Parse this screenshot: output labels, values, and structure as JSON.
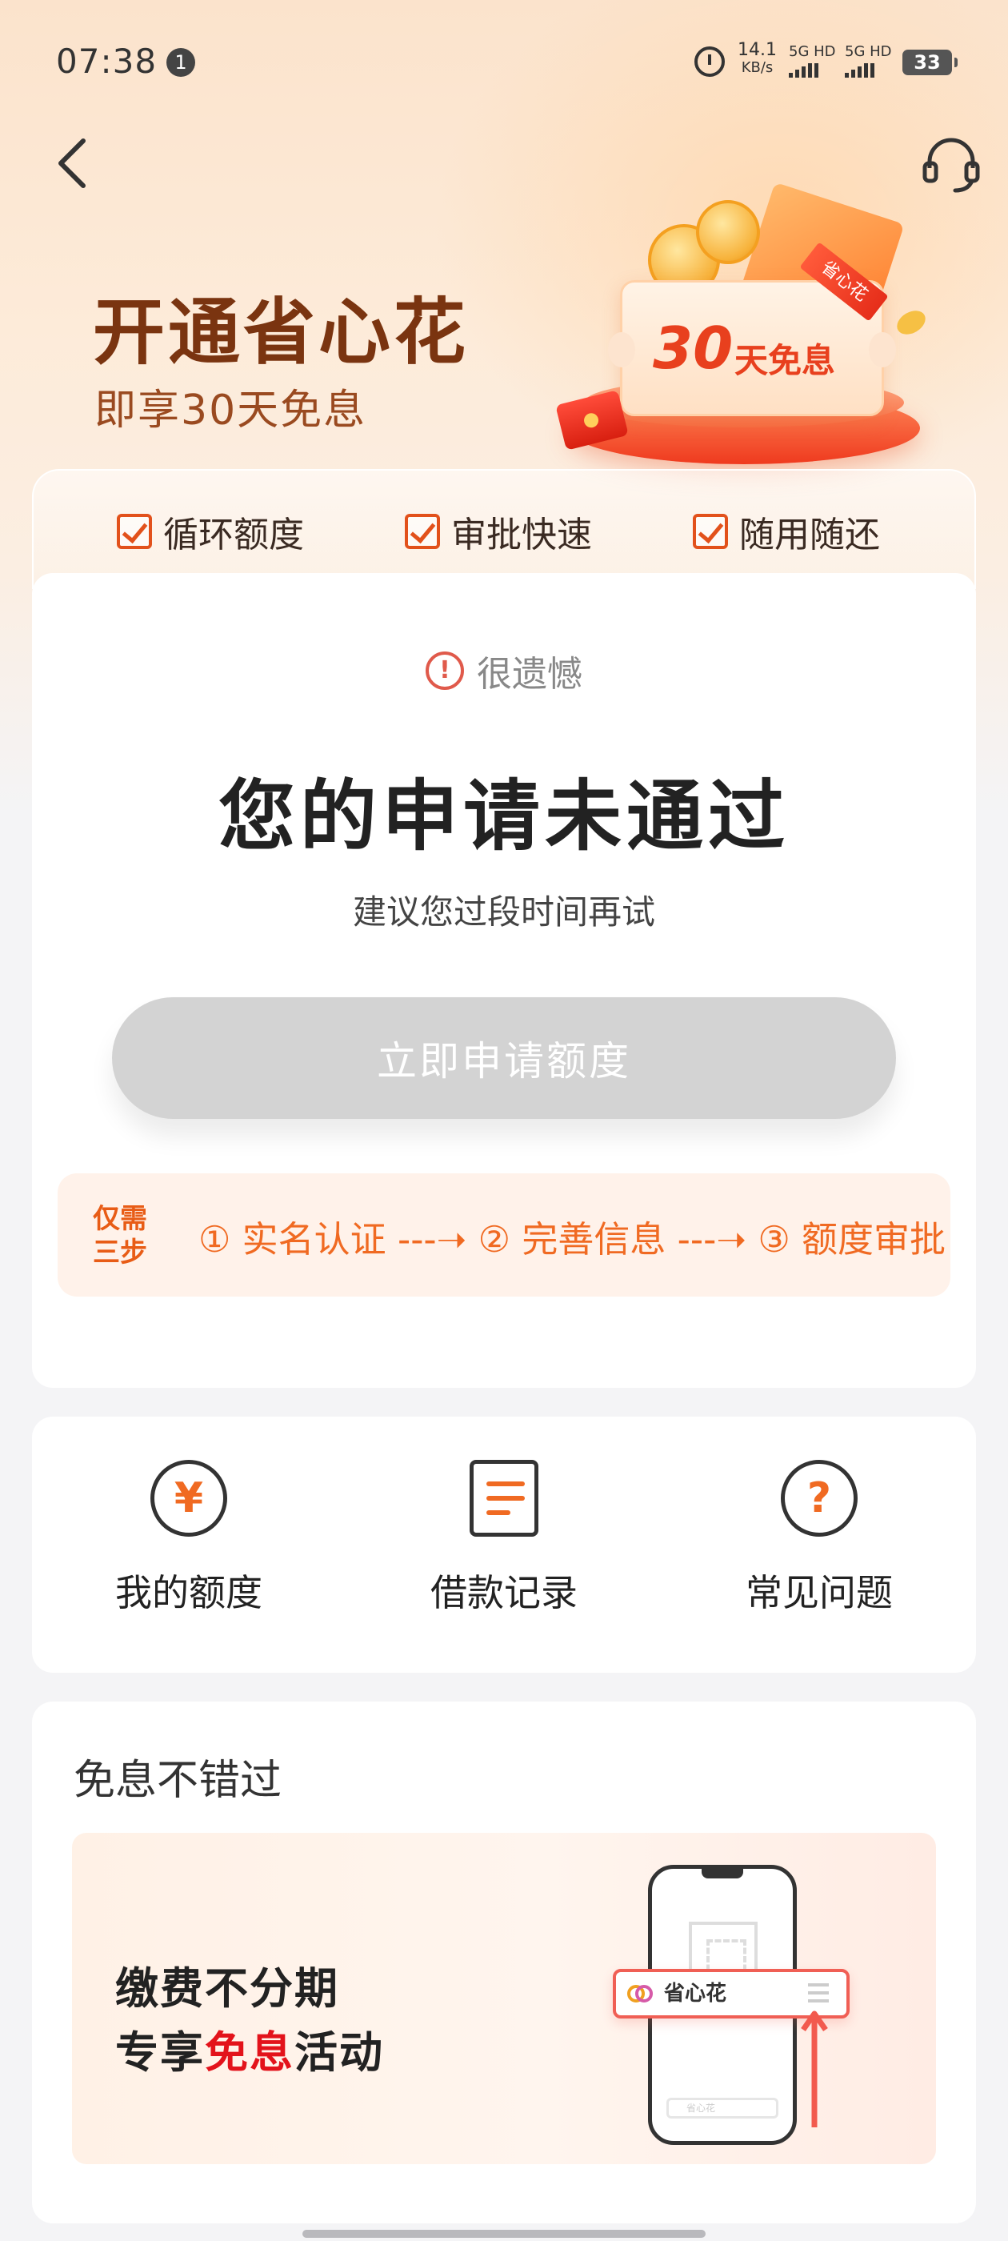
{
  "status_bar": {
    "time": "07:38",
    "notification_count": "1",
    "speed_value": "14.1",
    "speed_unit": "KB/s",
    "sim1_label": "5G HD",
    "sim2_label": "5G HD",
    "battery": "33"
  },
  "nav": {
    "back_icon": "chevron-left-icon",
    "service_icon": "headset-icon"
  },
  "hero": {
    "title": "开通省心花",
    "subtitle": "即享30天免息",
    "coupon_number": "30",
    "coupon_text": "天免息",
    "coupon_ribbon": "省心花"
  },
  "features": [
    {
      "label": "循环额度"
    },
    {
      "label": "审批快速"
    },
    {
      "label": "随用随还"
    }
  ],
  "result": {
    "notice": "很遗憾",
    "title": "您的申请未通过",
    "subtitle": "建议您过段时间再试",
    "apply_button": "立即申请额度"
  },
  "steps": {
    "tag_line1": "仅需",
    "tag_line2": "三步",
    "text": "① 实名认证 ---➝ ② 完善信息 ---➝ ③ 额度审批"
  },
  "quick_links": [
    {
      "label": "我的额度",
      "icon": "yen-circle-icon",
      "glyph": "¥"
    },
    {
      "label": "借款记录",
      "icon": "document-list-icon"
    },
    {
      "label": "常见问题",
      "icon": "question-circle-icon",
      "glyph": "?"
    }
  ],
  "promo": {
    "section_title": "免息不错过",
    "line1": "缴费不分期",
    "line2_prefix": "专享",
    "line2_highlight": "免息",
    "line2_suffix": "活动",
    "mini_card_label": "省心花",
    "phone_bar_text": "省心花"
  },
  "colors": {
    "accent": "#f06a22",
    "brand_dark": "#7a3410",
    "highlight_red": "#e3131b",
    "disabled_button": "#d3d3d3"
  }
}
